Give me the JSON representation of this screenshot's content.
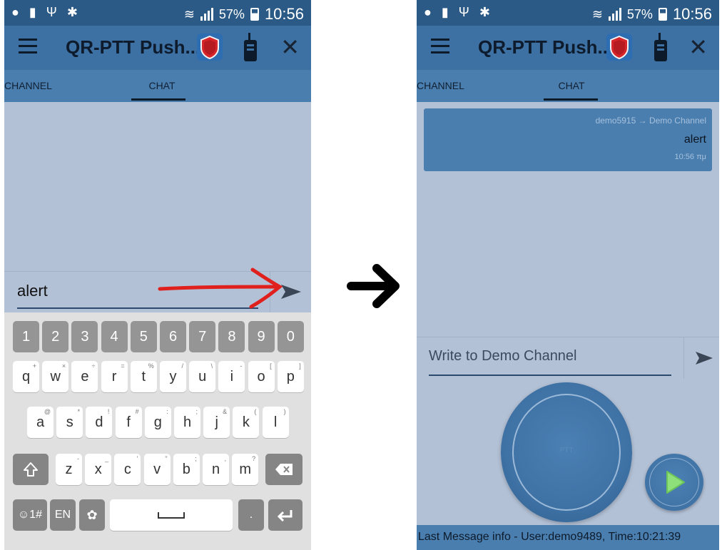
{
  "left_phone": {
    "status": {
      "signal_pct": "57%",
      "time": "10:56"
    },
    "app_title": "QR-PTT Push...",
    "tabs": {
      "channel": "CHANNEL",
      "chat": "CHAT"
    },
    "input_value": "alert",
    "keyboard": {
      "numbers": [
        "1",
        "2",
        "3",
        "4",
        "5",
        "6",
        "7",
        "8",
        "9",
        "0"
      ],
      "row1": [
        {
          "k": "q",
          "h": "+"
        },
        {
          "k": "w",
          "h": "×"
        },
        {
          "k": "e",
          "h": "÷"
        },
        {
          "k": "r",
          "h": "="
        },
        {
          "k": "t",
          "h": "%"
        },
        {
          "k": "y",
          "h": "/"
        },
        {
          "k": "u",
          "h": "\\"
        },
        {
          "k": "i",
          "h": "-"
        },
        {
          "k": "o",
          "h": "["
        },
        {
          "k": "p",
          "h": "]"
        }
      ],
      "row2": [
        {
          "k": "a",
          "h": "@"
        },
        {
          "k": "s",
          "h": "*"
        },
        {
          "k": "d",
          "h": "!"
        },
        {
          "k": "f",
          "h": "#"
        },
        {
          "k": "g",
          "h": ":"
        },
        {
          "k": "h",
          "h": ";"
        },
        {
          "k": "j",
          "h": "&"
        },
        {
          "k": "k",
          "h": "("
        },
        {
          "k": "l",
          "h": ")"
        }
      ],
      "row3": [
        {
          "k": "z",
          "h": "-"
        },
        {
          "k": "x",
          "h": "_"
        },
        {
          "k": "c",
          "h": "'"
        },
        {
          "k": "v",
          "h": "\""
        },
        {
          "k": "b",
          "h": ";"
        },
        {
          "k": "n",
          "h": ","
        },
        {
          "k": "m",
          "h": "?"
        }
      ],
      "symbols_key": "☺1#",
      "lang_key": "EN",
      "period_key": "."
    }
  },
  "right_phone": {
    "status": {
      "signal_pct": "57%",
      "time": "10:56"
    },
    "app_title": "QR-PTT Push...",
    "tabs": {
      "channel": "CHANNEL",
      "chat": "CHAT"
    },
    "message": {
      "route": "demo5915 → Demo Channel",
      "text": "alert",
      "time": "10:56 πμ"
    },
    "compose_placeholder": "Write to Demo Channel",
    "ptt_label": "PTT",
    "footer": "Last Message info - User:demo9489, Time:10:21:39"
  },
  "colors": {
    "status_bar": "#2c5a86",
    "app_bar": "#3e71a3",
    "tab_bar": "#4a7eaf",
    "content_bg": "#b3c1d6",
    "annotation_red": "#e0201c",
    "play_green": "#8ee07a"
  },
  "icons": [
    "menu-icon",
    "shield-logo-icon",
    "radio-icon",
    "close-icon",
    "send-icon",
    "backspace-icon",
    "shift-icon",
    "settings-icon",
    "enter-icon",
    "play-icon",
    "arrow-right-icon"
  ]
}
